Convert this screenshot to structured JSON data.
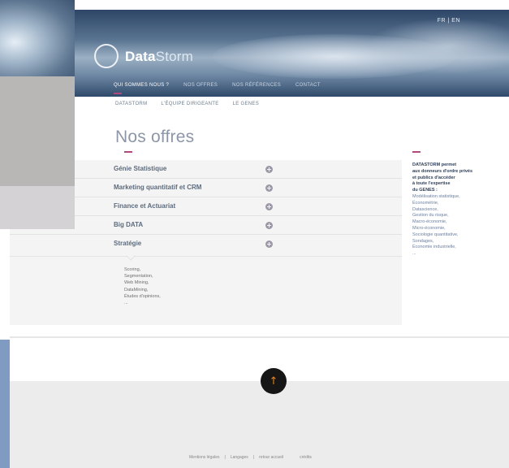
{
  "header": {
    "logo_bold": "Data",
    "logo_thin": "Storm",
    "lang_fr": "FR",
    "lang_sep": "|",
    "lang_en": "EN",
    "nav": [
      "QUI SOMMES NOUS ?",
      "NOS OFFRES",
      "NOS RÉFÉRENCES",
      "CONTACT"
    ]
  },
  "subnav": [
    "DATASTORM",
    "L'ÉQUIPE DIRIGEANTE",
    "LE GENES"
  ],
  "main": {
    "title": "Nos offres",
    "accordion": [
      {
        "label": "Génie Statistique"
      },
      {
        "label": "Marketing quantitatif et CRM"
      },
      {
        "label": "Finance et Actuariat"
      },
      {
        "label": "Big DATA"
      },
      {
        "label": "Stratégie"
      }
    ],
    "open_panel": [
      "Scoring,",
      "Segmentation,",
      "Web Mining,",
      "DataMining,",
      "Études d'opinions,",
      "..."
    ]
  },
  "sidebar": {
    "intro": [
      "DATASTORM permet",
      "aux donneurs d'ordre privés",
      "et publics d'accéder",
      "à toute l'expertise",
      "du GENES :"
    ],
    "items": [
      "Modélisation statistique,",
      "Économétrie,",
      "Datascience,",
      "Gestion du risque,",
      "Macro-économie,",
      "Micro-économie,",
      "Sociologie quantitative,",
      "Sondages,",
      "Économie industrielle,",
      "..."
    ]
  },
  "footer": {
    "links": [
      "Mentions légales",
      "|",
      "Langages",
      "|",
      "retour accueil",
      "crédits"
    ],
    "up_glyph": "↑"
  },
  "colors": {
    "accent": "#b04a7c",
    "up_arrow": "#e8841f"
  }
}
